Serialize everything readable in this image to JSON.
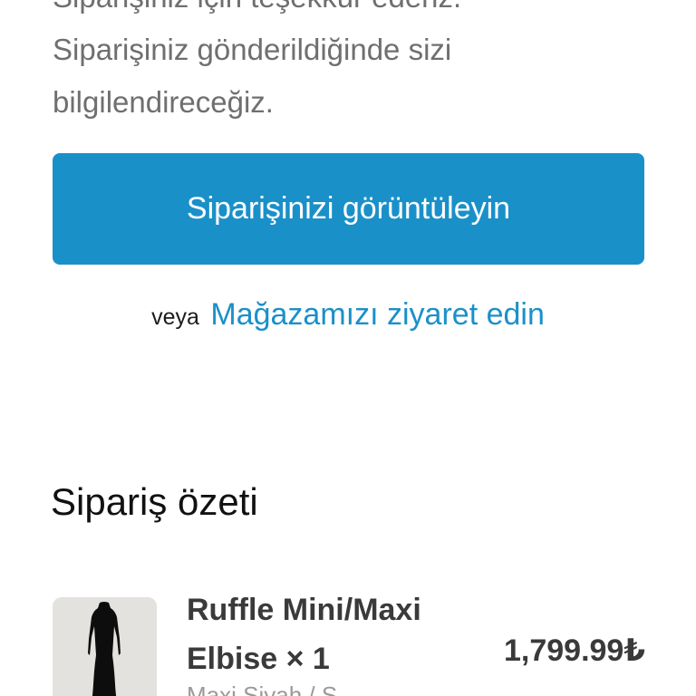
{
  "intro": {
    "line1": "Siparişiniz gönderildiğinde sizi bilgilendireceğiz.",
    "line0": "Siparişiniz için teşekkür ederiz.",
    "line1a": "Siparişiniz gönderildiğinde sizi",
    "line1b": "bilgilendireceğiz."
  },
  "actions": {
    "view_order_label": "Siparişinizi görüntüleyin",
    "or_label": "veya",
    "visit_store_label": "Mağazamızı ziyaret edin"
  },
  "colors": {
    "accent": "#1a90c9",
    "muted_text": "#6f6f6f",
    "thumb_bg": "#e4e2df",
    "dress": "#0d0d0d"
  },
  "summary": {
    "heading": "Sipariş özeti",
    "items": [
      {
        "name_line1": "Ruffle Mini/Maxi",
        "name_line2": "Elbise × 1",
        "variant": "Maxi Siyah / S",
        "price": "1,799.99₺",
        "image_icon": "black-maxi-dress"
      }
    ]
  }
}
